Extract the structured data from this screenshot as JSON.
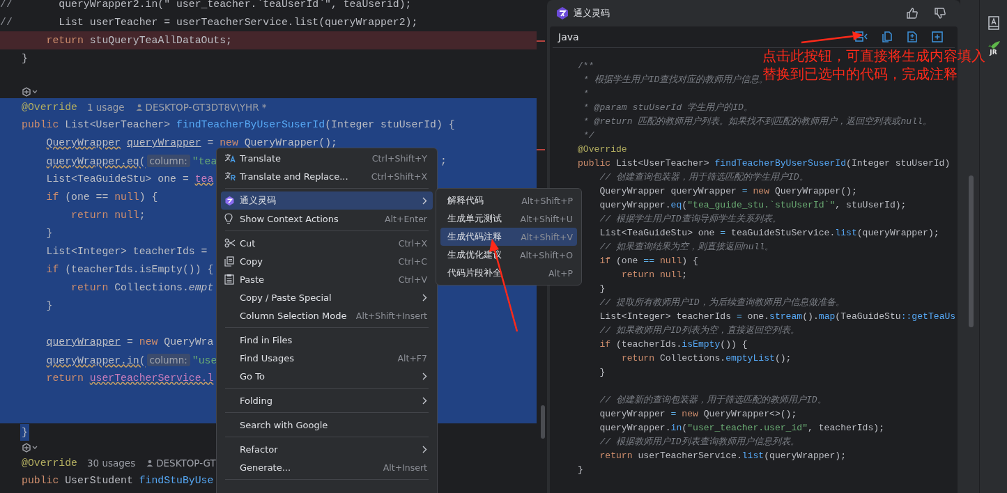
{
  "editor": {
    "lines": [
      {
        "kind": "code",
        "gutter": "//",
        "selected": false,
        "error": false,
        "tokens": [
          {
            "kind": "plain",
            "text": "      queryWrapper2.in(\" user_teacher.`teaUserId`\", teaUserid);"
          }
        ]
      },
      {
        "kind": "code",
        "gutter": "//",
        "selected": false,
        "error": false,
        "tokens": [
          {
            "kind": "plain",
            "text": "      List userTeacher = userTeacherService.list(queryWrapper2);"
          }
        ]
      },
      {
        "kind": "code",
        "selected": false,
        "error": true,
        "tokens": [
          {
            "kind": "keyword",
            "text": "    return"
          },
          {
            "kind": "plain",
            "text": " stuQueryTeaAllDataOuts;"
          }
        ]
      },
      {
        "kind": "code",
        "selected": false,
        "error": false,
        "tokens": [
          {
            "kind": "plain",
            "text": "}"
          }
        ]
      },
      {
        "kind": "code",
        "selected": false,
        "error": false
      },
      {
        "kind": "marker"
      },
      {
        "kind": "meta",
        "selected": true,
        "annotation": "@Override",
        "usages": "1 usage",
        "author": "DESKTOP-GT3DT8V\\YHR *"
      },
      {
        "kind": "code",
        "selected": true,
        "error": false,
        "tokens": [
          {
            "kind": "keyword",
            "text": "public"
          },
          {
            "kind": "plain",
            "text": " List<UserTeacher> "
          },
          {
            "kind": "function",
            "text": "findTeacherByUserSuserId"
          },
          {
            "kind": "plain",
            "text": "(Integer stuUserId) {"
          }
        ]
      },
      {
        "kind": "code",
        "selected": true,
        "error": false,
        "tokens": [
          {
            "kind": "wavy",
            "text": "    QueryWrapper"
          },
          {
            "kind": "underline",
            "text": " queryWrapper"
          },
          {
            "kind": "plain",
            "text": " = "
          },
          {
            "kind": "keyword",
            "text": "new"
          },
          {
            "kind": "plain",
            "text": " QueryWrapper();"
          }
        ]
      },
      {
        "kind": "code",
        "selected": true,
        "error": false,
        "tokens": [
          {
            "kind": "wavy",
            "text": "    queryWrapper.eq("
          },
          {
            "kind": "hint",
            "text": "column:"
          },
          {
            "kind": "string",
            "text": "\"tea"
          }
        ],
        "tail": ";"
      },
      {
        "kind": "code",
        "selected": true,
        "error": false,
        "tokens": [
          {
            "kind": "plain",
            "text": "    List<TeaGuideStu> one = "
          },
          {
            "kind": "field",
            "text": "tea"
          }
        ]
      },
      {
        "kind": "code",
        "selected": true,
        "error": false,
        "tokens": [
          {
            "kind": "keyword",
            "text": "    if"
          },
          {
            "kind": "plain",
            "text": " (one == "
          },
          {
            "kind": "keyword",
            "text": "null"
          },
          {
            "kind": "plain",
            "text": ") {"
          }
        ]
      },
      {
        "kind": "code",
        "selected": true,
        "error": false,
        "tokens": [
          {
            "kind": "keyword",
            "text": "        return null"
          },
          {
            "kind": "plain",
            "text": ";"
          }
        ]
      },
      {
        "kind": "code",
        "selected": true,
        "error": false,
        "tokens": [
          {
            "kind": "plain",
            "text": "    }"
          }
        ]
      },
      {
        "kind": "code",
        "selected": true,
        "error": false,
        "tokens": [
          {
            "kind": "plain",
            "text": "    List<Integer> teacherIds ="
          }
        ]
      },
      {
        "kind": "code",
        "selected": true,
        "error": false,
        "tokens": [
          {
            "kind": "keyword",
            "text": "    if"
          },
          {
            "kind": "plain",
            "text": " (teacherIds.isEmpty()) {"
          }
        ]
      },
      {
        "kind": "code",
        "selected": true,
        "error": false,
        "tokens": [
          {
            "kind": "keyword",
            "text": "        return"
          },
          {
            "kind": "plain",
            "text": " Collections."
          },
          {
            "kind": "italic",
            "text": "empt"
          }
        ]
      },
      {
        "kind": "code",
        "selected": true,
        "error": false,
        "tokens": [
          {
            "kind": "plain",
            "text": "    }"
          }
        ]
      },
      {
        "kind": "code",
        "selected": true,
        "error": false
      },
      {
        "kind": "code",
        "selected": true,
        "error": false,
        "tokens": [
          {
            "kind": "underline",
            "text": "    queryWrapper"
          },
          {
            "kind": "plain",
            "text": " = "
          },
          {
            "kind": "keyword",
            "text": "new"
          },
          {
            "kind": "plain",
            "text": " QueryWra"
          }
        ]
      },
      {
        "kind": "code",
        "selected": true,
        "error": false,
        "tokens": [
          {
            "kind": "wavy",
            "text": "    queryWrapper.in("
          },
          {
            "kind": "hint",
            "text": "column:"
          },
          {
            "kind": "string",
            "text": "\"use"
          }
        ]
      },
      {
        "kind": "code",
        "selected": true,
        "error": false,
        "tokens": [
          {
            "kind": "keyword",
            "text": "    return"
          },
          {
            "kind": "field",
            "text": " userTeacherService.l"
          }
        ]
      },
      {
        "kind": "code",
        "selected": true,
        "error": false
      },
      {
        "kind": "code",
        "selected": true,
        "error": false
      },
      {
        "kind": "code",
        "selected": true,
        "error": false,
        "tokens": [
          {
            "kind": "plain",
            "text": "}"
          }
        ]
      },
      {
        "kind": "marker"
      },
      {
        "kind": "meta",
        "selected": false,
        "annotation": "@Override",
        "usages": "30 usages",
        "author": "DESKTOP-GT"
      },
      {
        "kind": "code",
        "selected": false,
        "error": false,
        "tokens": [
          {
            "kind": "keyword",
            "text": "public"
          },
          {
            "kind": "plain",
            "text": " UserStudent "
          },
          {
            "kind": "function",
            "text": "findStuByUse"
          }
        ]
      }
    ]
  },
  "context_menu": {
    "groups": [
      [
        {
          "label": "Translate",
          "shortcut": "Ctrl+Shift+Y",
          "submenu": false,
          "selected": false
        },
        {
          "label": "Translate and Replace...",
          "shortcut": "Ctrl+Shift+X",
          "submenu": false,
          "selected": false
        }
      ],
      [
        {
          "label": "通义灵码",
          "submenu": true,
          "selected": true
        },
        {
          "label": "Show Context Actions",
          "shortcut": "Alt+Enter",
          "submenu": false,
          "selected": false
        }
      ],
      [
        {
          "label": "Cut",
          "shortcut": "Ctrl+X",
          "submenu": false,
          "selected": false
        },
        {
          "label": "Copy",
          "shortcut": "Ctrl+C",
          "submenu": false,
          "selected": false
        },
        {
          "label": "Paste",
          "shortcut": "Ctrl+V",
          "submenu": false,
          "selected": false
        },
        {
          "label": "Copy / Paste Special",
          "submenu": true,
          "selected": false
        },
        {
          "label": "Column Selection Mode",
          "shortcut": "Alt+Shift+Insert",
          "submenu": false,
          "selected": false
        }
      ],
      [
        {
          "label": "Find in Files",
          "submenu": false,
          "selected": false
        },
        {
          "label": "Find Usages",
          "shortcut": "Alt+F7",
          "submenu": false,
          "selected": false
        },
        {
          "label": "Go To",
          "submenu": true,
          "selected": false
        }
      ],
      [
        {
          "label": "Folding",
          "submenu": true,
          "selected": false
        }
      ],
      [
        {
          "label": "Search with Google",
          "submenu": false,
          "selected": false
        }
      ],
      [
        {
          "label": "Refactor",
          "submenu": true,
          "selected": false
        },
        {
          "label": "Generate...",
          "shortcut": "Alt+Insert",
          "submenu": false,
          "selected": false
        }
      ]
    ]
  },
  "submenu": {
    "items": [
      {
        "label": "解释代码",
        "shortcut": "Alt+Shift+P",
        "selected": false
      },
      {
        "label": "生成单元测试",
        "shortcut": "Alt+Shift+U",
        "selected": false
      },
      {
        "label": "生成代码注释",
        "shortcut": "Alt+Shift+V",
        "selected": true
      },
      {
        "label": "生成优化建议",
        "shortcut": "Alt+Shift+O",
        "selected": false
      },
      {
        "label": "代码片段补全",
        "shortcut": "Alt+P",
        "selected": false
      }
    ]
  },
  "assistant": {
    "title": "通义灵码",
    "language": "Java",
    "code": [
      {
        "kind": "code",
        "tokens": [
          {
            "kind": "doc",
            "text": "/**"
          }
        ]
      },
      {
        "kind": "code",
        "tokens": [
          {
            "kind": "comment",
            "text": " * 根据学生用户ID查找对应的教师用户信息。"
          }
        ]
      },
      {
        "kind": "code",
        "tokens": [
          {
            "kind": "comment",
            "text": " *"
          }
        ]
      },
      {
        "kind": "code",
        "tokens": [
          {
            "kind": "comment",
            "text": " * @param stuUserId 学生用户的ID。"
          }
        ]
      },
      {
        "kind": "code",
        "tokens": [
          {
            "kind": "comment",
            "text": " * @return 匹配的教师用户列表。如果找不到匹配的教师用户，返回空列表或null。"
          }
        ]
      },
      {
        "kind": "code",
        "tokens": [
          {
            "kind": "comment",
            "text": " */"
          }
        ]
      },
      {
        "kind": "code",
        "tokens": [
          {
            "kind": "annotation",
            "text": "@Override"
          }
        ]
      },
      {
        "kind": "code",
        "tokens": [
          {
            "kind": "keyword",
            "text": "public"
          },
          {
            "kind": "plain",
            "text": " List<UserTeacher> "
          },
          {
            "kind": "function",
            "text": "findTeacherByUserSuserId"
          },
          {
            "kind": "plain",
            "text": "(Integer stuUserId)"
          }
        ]
      },
      {
        "kind": "code",
        "tokens": [
          {
            "kind": "comment",
            "text": "    // 创建查询包装器，用于筛选匹配的学生用户ID。"
          }
        ]
      },
      {
        "kind": "code",
        "tokens": [
          {
            "kind": "plain",
            "text": "    QueryWrapper queryWrapper "
          },
          {
            "kind": "operator",
            "text": "="
          },
          {
            "kind": "keyword",
            "text": " new"
          },
          {
            "kind": "plain",
            "text": " QueryWrapper();"
          }
        ]
      },
      {
        "kind": "code",
        "tokens": [
          {
            "kind": "plain",
            "text": "    queryWrapper."
          },
          {
            "kind": "function",
            "text": "eq"
          },
          {
            "kind": "plain",
            "text": "("
          },
          {
            "kind": "string",
            "text": "\"tea_guide_stu.`stuUserId`\""
          },
          {
            "kind": "plain",
            "text": ", stuUserId);"
          }
        ]
      },
      {
        "kind": "code",
        "tokens": [
          {
            "kind": "comment",
            "text": "    // 根据学生用户ID查询导师学生关系列表。"
          }
        ]
      },
      {
        "kind": "code",
        "tokens": [
          {
            "kind": "plain",
            "text": "    List<TeaGuideStu> one "
          },
          {
            "kind": "operator",
            "text": "="
          },
          {
            "kind": "plain",
            "text": " teaGuideStuService."
          },
          {
            "kind": "function",
            "text": "list"
          },
          {
            "kind": "plain",
            "text": "(queryWrapper);"
          }
        ]
      },
      {
        "kind": "code",
        "tokens": [
          {
            "kind": "comment",
            "text": "    // 如果查询结果为空，则直接返回null。"
          }
        ]
      },
      {
        "kind": "code",
        "tokens": [
          {
            "kind": "keyword",
            "text": "    if"
          },
          {
            "kind": "plain",
            "text": " (one "
          },
          {
            "kind": "operator",
            "text": "=="
          },
          {
            "kind": "keyword",
            "text": " null"
          },
          {
            "kind": "plain",
            "text": ") {"
          }
        ]
      },
      {
        "kind": "code",
        "tokens": [
          {
            "kind": "keyword",
            "text": "        return null"
          },
          {
            "kind": "plain",
            "text": ";"
          }
        ]
      },
      {
        "kind": "code",
        "tokens": [
          {
            "kind": "plain",
            "text": "    }"
          }
        ]
      },
      {
        "kind": "code",
        "tokens": [
          {
            "kind": "comment",
            "text": "    // 提取所有教师用户ID，为后续查询教师用户信息做准备。"
          }
        ]
      },
      {
        "kind": "code",
        "tokens": [
          {
            "kind": "plain",
            "text": "    List<Integer> teacherIds "
          },
          {
            "kind": "operator",
            "text": "="
          },
          {
            "kind": "plain",
            "text": " one."
          },
          {
            "kind": "function",
            "text": "stream"
          },
          {
            "kind": "plain",
            "text": "()."
          },
          {
            "kind": "function",
            "text": "map"
          },
          {
            "kind": "plain",
            "text": "(TeaGuideStu"
          },
          {
            "kind": "function",
            "text": "::getTeaUs"
          }
        ]
      },
      {
        "kind": "code",
        "tokens": [
          {
            "kind": "comment",
            "text": "    // 如果教师用户ID列表为空，直接返回空列表。"
          }
        ]
      },
      {
        "kind": "code",
        "tokens": [
          {
            "kind": "keyword",
            "text": "    if"
          },
          {
            "kind": "plain",
            "text": " (teacherIds."
          },
          {
            "kind": "function",
            "text": "isEmpty"
          },
          {
            "kind": "plain",
            "text": "()) {"
          }
        ]
      },
      {
        "kind": "code",
        "tokens": [
          {
            "kind": "keyword",
            "text": "        return"
          },
          {
            "kind": "plain",
            "text": " Collections."
          },
          {
            "kind": "function",
            "text": "emptyList"
          },
          {
            "kind": "plain",
            "text": "();"
          }
        ]
      },
      {
        "kind": "code",
        "tokens": [
          {
            "kind": "plain",
            "text": "    }"
          }
        ]
      },
      {
        "kind": "blank"
      },
      {
        "kind": "code",
        "tokens": [
          {
            "kind": "comment",
            "text": "    // 创建新的查询包装器，用于筛选匹配的教师用户ID。"
          }
        ]
      },
      {
        "kind": "code",
        "tokens": [
          {
            "kind": "plain",
            "text": "    queryWrapper "
          },
          {
            "kind": "operator",
            "text": "="
          },
          {
            "kind": "keyword",
            "text": " new"
          },
          {
            "kind": "plain",
            "text": " QueryWrapper<>();"
          }
        ]
      },
      {
        "kind": "code",
        "tokens": [
          {
            "kind": "plain",
            "text": "    queryWrapper."
          },
          {
            "kind": "function",
            "text": "in"
          },
          {
            "kind": "plain",
            "text": "("
          },
          {
            "kind": "string",
            "text": "\"user_teacher.user_id\""
          },
          {
            "kind": "plain",
            "text": ", teacherIds);"
          }
        ]
      },
      {
        "kind": "code",
        "tokens": [
          {
            "kind": "comment",
            "text": "    // 根据教师用户ID列表查询教师用户信息列表。"
          }
        ]
      },
      {
        "kind": "code",
        "tokens": [
          {
            "kind": "keyword",
            "text": "    return"
          },
          {
            "kind": "plain",
            "text": " userTeacherService."
          },
          {
            "kind": "function",
            "text": "list"
          },
          {
            "kind": "plain",
            "text": "(queryWrapper);"
          }
        ]
      },
      {
        "kind": "code",
        "tokens": [
          {
            "kind": "plain",
            "text": "}"
          }
        ]
      }
    ]
  },
  "right_toolbar": {
    "badge": "JR"
  },
  "annotation": {
    "lines": [
      "点击此按钮，可直接将生成内容填入",
      "替换到已选中的代码，完成注释"
    ]
  }
}
